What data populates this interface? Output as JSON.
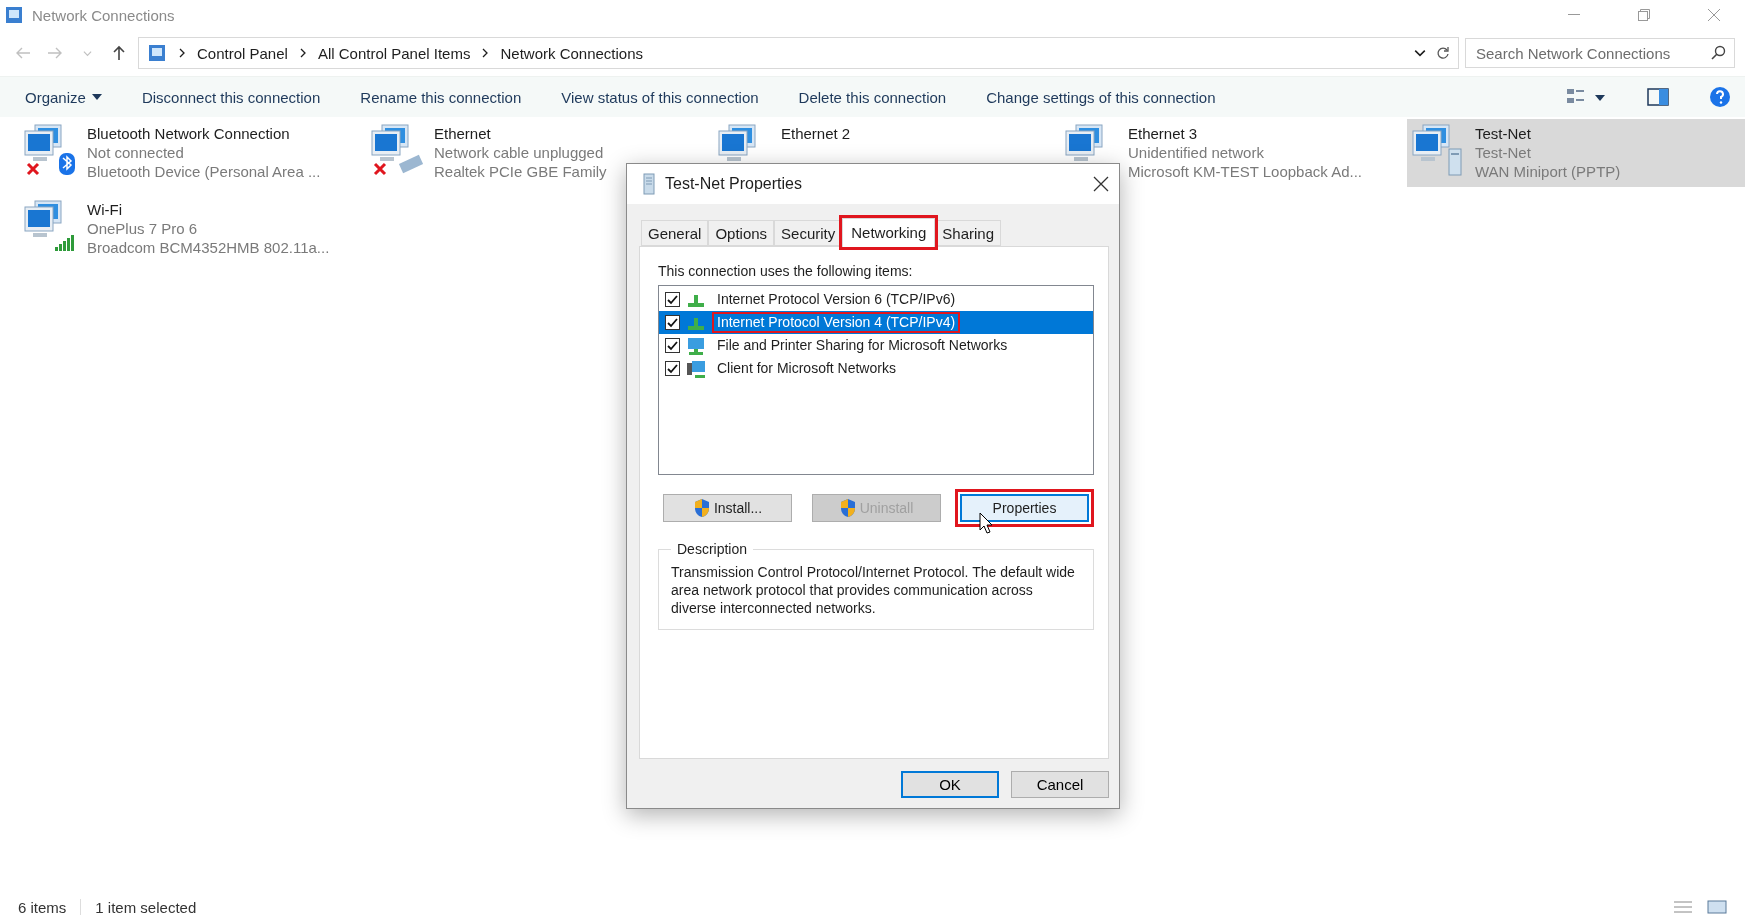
{
  "window": {
    "title": "Network Connections"
  },
  "address_bar": {
    "breadcrumbs": [
      "Control Panel",
      "All Control Panel Items",
      "Network Connections"
    ]
  },
  "search": {
    "placeholder": "Search Network Connections"
  },
  "command_bar": {
    "organize": "Organize",
    "commands": [
      "Disconnect this connection",
      "Rename this connection",
      "View status of this connection",
      "Delete this connection",
      "Change settings of this connection"
    ]
  },
  "connections": [
    {
      "kind": "bluetooth",
      "name": "Bluetooth Network Connection",
      "status": "Not connected",
      "device": "Bluetooth Device (Personal Area ...",
      "disconnected": true,
      "selected": false
    },
    {
      "kind": "ethernet",
      "name": "Ethernet",
      "status": "Network cable unplugged",
      "device": "Realtek PCIe GBE Family",
      "disconnected": true,
      "selected": false
    },
    {
      "kind": "ethernet2",
      "name": "Ethernet 2",
      "selected": false
    },
    {
      "kind": "loopback",
      "name": "Ethernet 3",
      "status": "Unidentified network",
      "device": "Microsoft KM-TEST Loopback Ad...",
      "disconnected": false,
      "selected": false
    },
    {
      "kind": "vpn",
      "name": "Test-Net",
      "status": "Test-Net",
      "device": "WAN Miniport (PPTP)",
      "disconnected": false,
      "selected": true
    },
    {
      "kind": "wifi",
      "name": "Wi-Fi",
      "status": "OnePlus 7 Pro 6",
      "device": "Broadcom BCM4352HMB 802.11a...",
      "disconnected": false,
      "selected": false
    }
  ],
  "status_bar": {
    "count": "6 items",
    "selection": "1 item selected"
  },
  "dialog": {
    "title": "Test-Net Properties",
    "tabs": [
      {
        "label": "General",
        "selected": false,
        "highlighted": false
      },
      {
        "label": "Options",
        "selected": false,
        "highlighted": false
      },
      {
        "label": "Security",
        "selected": false,
        "highlighted": false
      },
      {
        "label": "Networking",
        "selected": true,
        "highlighted": true
      },
      {
        "label": "Sharing",
        "selected": false,
        "highlighted": false
      }
    ],
    "list_label": "This connection uses the following items:",
    "items": [
      {
        "kind": "protocol",
        "label": "Internet Protocol Version 6 (TCP/IPv6)",
        "checked": true,
        "selected": false,
        "highlighted": false
      },
      {
        "kind": "protocol",
        "label": "Internet Protocol Version 4 (TCP/IPv4)",
        "checked": true,
        "selected": true,
        "highlighted": true
      },
      {
        "kind": "service",
        "label": "File and Printer Sharing for Microsoft Networks",
        "checked": true,
        "selected": false,
        "highlighted": false
      },
      {
        "kind": "client",
        "label": "Client for Microsoft Networks",
        "checked": true,
        "selected": false,
        "highlighted": false
      }
    ],
    "buttons": [
      {
        "label": "Install...",
        "shield": true,
        "disabled": false,
        "focused": false,
        "highlighted": false
      },
      {
        "label": "Uninstall",
        "shield": true,
        "disabled": true,
        "focused": false,
        "highlighted": false
      },
      {
        "label": "Properties",
        "shield": false,
        "disabled": false,
        "focused": true,
        "highlighted": true
      }
    ],
    "description": {
      "legend": "Description",
      "text": "Transmission Control Protocol/Internet Protocol. The default wide area network protocol that provides communication across diverse interconnected networks."
    },
    "footer_buttons": [
      {
        "label": "OK",
        "default": true
      },
      {
        "label": "Cancel",
        "default": false
      }
    ]
  }
}
